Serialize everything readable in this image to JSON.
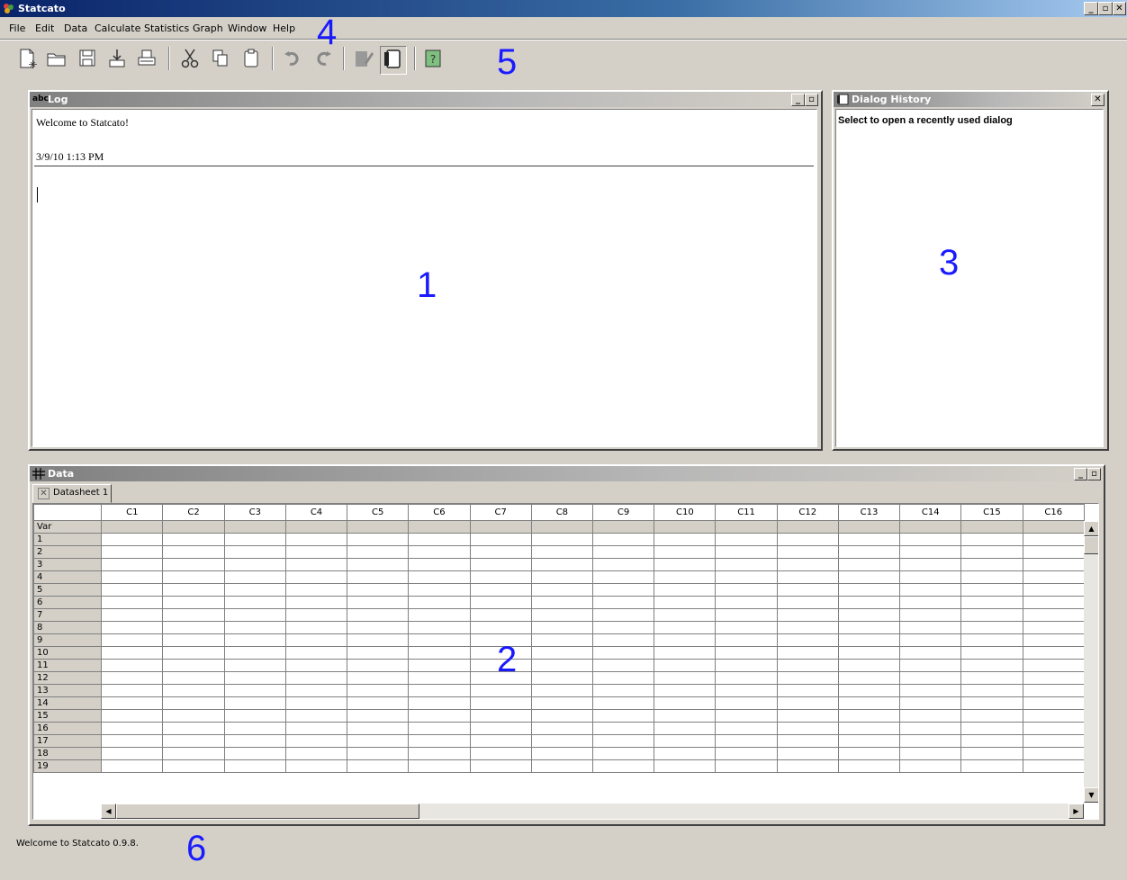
{
  "window": {
    "title": "Statcato",
    "controls": {
      "minimize": "_",
      "maximize": "▫",
      "close": "✕"
    }
  },
  "menu": {
    "items": [
      {
        "label": "File"
      },
      {
        "label": "Edit"
      },
      {
        "label": "Data"
      },
      {
        "label": "Calculate"
      },
      {
        "label": "Statistics"
      },
      {
        "label": "Graph"
      },
      {
        "label": "Window"
      },
      {
        "label": "Help"
      }
    ]
  },
  "toolbar": {
    "icons": [
      "new-file-icon",
      "open-folder-icon",
      "save-icon",
      "import-icon",
      "print-icon",
      "cut-icon",
      "copy-icon",
      "paste-icon",
      "undo-icon",
      "redo-icon",
      "edit-dialog-icon",
      "dialog-history-icon",
      "help-icon"
    ]
  },
  "log": {
    "title": "Log",
    "icon_label": "abc",
    "welcome": "Welcome to Statcato!",
    "timestamp": "3/9/10 1:13 PM"
  },
  "dialog_history": {
    "title": "Dialog History",
    "hint": "Select to open a recently used dialog"
  },
  "data": {
    "title": "Data",
    "tab_label": "Datasheet 1",
    "columns": [
      "C1",
      "C2",
      "C3",
      "C4",
      "C5",
      "C6",
      "C7",
      "C8",
      "C9",
      "C10",
      "C11",
      "C12",
      "C13",
      "C14",
      "C15",
      "C16"
    ],
    "var_label": "Var",
    "rows": [
      "1",
      "2",
      "3",
      "4",
      "5",
      "6",
      "7",
      "8",
      "9",
      "10",
      "11",
      "12",
      "13",
      "14",
      "15",
      "16",
      "17",
      "18",
      "19"
    ]
  },
  "status": {
    "text": "Welcome to Statcato 0.9.8."
  },
  "annotations": [
    "1",
    "2",
    "3",
    "4",
    "5",
    "6"
  ],
  "colors": {
    "titlebar_start": "#0a246a",
    "annotation": "#1a1aff",
    "chrome": "#d4d0c8"
  }
}
